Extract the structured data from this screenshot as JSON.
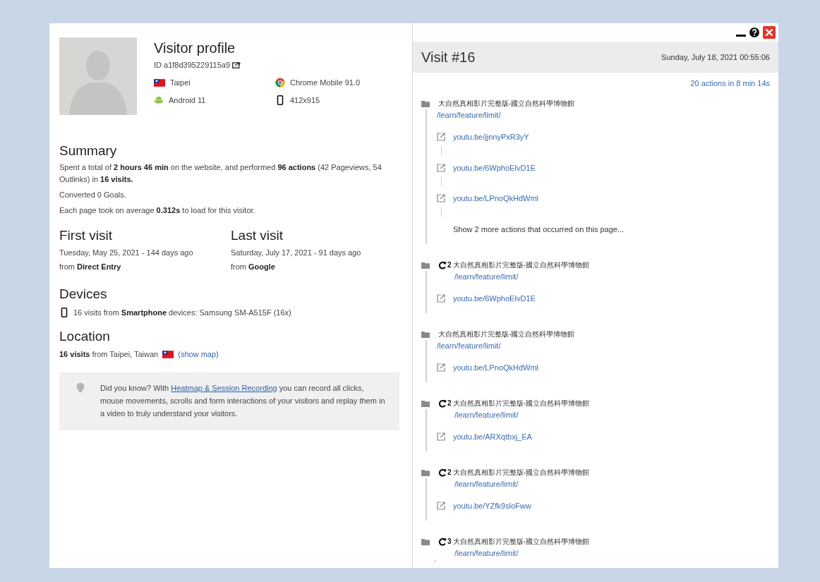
{
  "profile": {
    "title": "Visitor profile",
    "id": "ID a1f8d395229115a9",
    "city": "Taipei",
    "os": "Android 11",
    "browser": "Chrome Mobile 91.0",
    "resolution": "412x915"
  },
  "summary": {
    "heading": "Summary",
    "lines": [
      "Spent a total of **2 hours 46 min** on the website, and performed **96 actions** (42 Pageviews, 54 Outlinks) in **16 visits.**",
      "Converted 0 Goals.",
      "Each page took on average **0.312s** to load for this visitor."
    ]
  },
  "first_visit": {
    "heading": "First visit",
    "date": "Tuesday, May 25, 2021 - 144 days ago",
    "source": "from **Direct Entry**"
  },
  "last_visit": {
    "heading": "Last visit",
    "date": "Saturday, July 17, 2021 - 91 days ago",
    "source": "from **Google**"
  },
  "devices": {
    "heading": "Devices",
    "text": "16 visits from **Smartphone** devices: Samsung SM-A515F (16x)"
  },
  "location": {
    "heading": "Location",
    "text": "**16 visits** from Taipei, Taiwan",
    "link": "(show map)"
  },
  "tip": {
    "before": "Did you know? With ",
    "link": "Heatmap & Session Recording",
    "after": " you can record all clicks, mouse movements, scrolls and form interactions of your visitors and replay them in a video to truly understand your visitors."
  },
  "visit": {
    "title": "Visit #16",
    "date": "Sunday, July 18, 2021 00:55:06",
    "summary": "20 actions in 8 min 14s",
    "actions": [
      {
        "title": "大自然真相影片完整版-國立自然科學博物館",
        "url": "/learn/feature/limit/",
        "outlinks": [
          "youtu.be/jjnnyPxR3yY",
          "youtu.be/6WphoElvD1E",
          "youtu.be/LPnoQkHdWml"
        ],
        "more": "Show 2 more actions that occurred on this page..."
      },
      {
        "title": "大自然真相影片完整版-國立自然科學博物館",
        "url": "/learn/feature/limit/",
        "reloads": "2",
        "outlinks": [
          "youtu.be/6WphoElvD1E"
        ]
      },
      {
        "title": "大自然真相影片完整版-國立自然科學博物館",
        "url": "/learn/feature/limit/",
        "outlinks": [
          "youtu.be/LPnoQkHdWml"
        ]
      },
      {
        "title": "大自然真相影片完整版-國立自然科學博物館",
        "url": "/learn/feature/limit/",
        "reloads": "2",
        "outlinks": [
          "youtu.be/ARXqtbxj_EA"
        ]
      },
      {
        "title": "大自然真相影片完整版-國立自然科學博物館",
        "url": "/learn/feature/limit/",
        "reloads": "2",
        "outlinks": [
          "youtu.be/YZfk9sloFww"
        ]
      },
      {
        "title": "大自然真相影片完整版-國立自然科學博物館",
        "url": "/learn/feature/limit/",
        "reloads": "3"
      }
    ]
  }
}
